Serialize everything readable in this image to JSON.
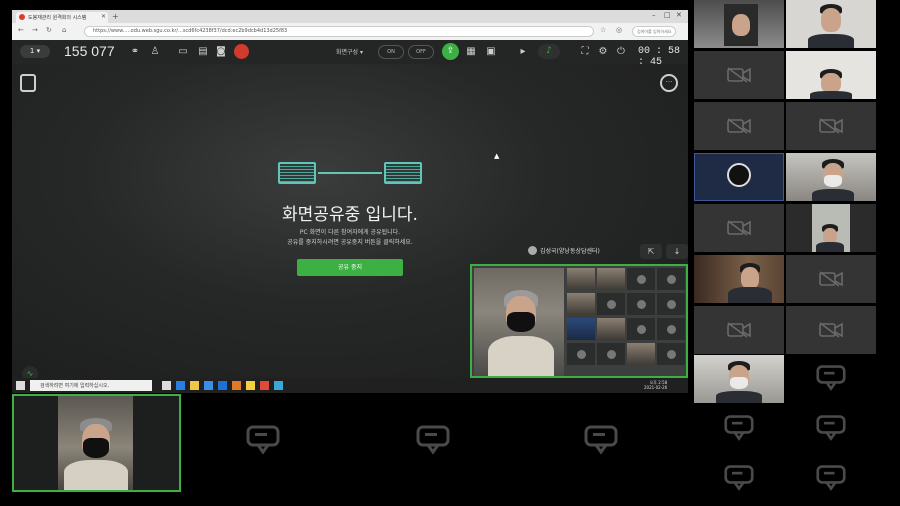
{
  "browser": {
    "tab_title": "도봉재관리 원격회의 시스템",
    "url": "https://www.....odu.web.sgu.co.kr/...scd6fc4238f37/dcd:ec2b9dcb4d13d25f83",
    "search_placeholder": "검색어를 입력하세요"
  },
  "toolbar": {
    "people_count": "1 ▾",
    "meeting_id": "155 077",
    "layout_label": "화면구성 ▾",
    "on_label": "ON",
    "off_label": "OFF",
    "timer": "00 : 58 : 45"
  },
  "share": {
    "title": "화면공유중 입니다.",
    "desc1": "PC 화면이 다른 참여자에게 공유됩니다.",
    "desc2": "공유를 중지하시려면 공유중지 버튼을 클릭하세요.",
    "stop_label": "공유 중지"
  },
  "speaker": {
    "name": "김성국(양낭동상담센터)"
  },
  "taskbar": {
    "search_placeholder": "검색하려면 여기에 입력하십시오.",
    "time": "오후 2:58",
    "date": "2021-02-26"
  },
  "colors": {
    "accent": "#3cb043",
    "record": "#d03b2e",
    "share_art": "#5fc6b8"
  },
  "icons": [
    "notes-icon",
    "chat-icon",
    "camera-off-icon",
    "chat-placeholder-icon",
    "record-icon",
    "mic-icon",
    "share-screen-icon",
    "audio-level-icon"
  ]
}
